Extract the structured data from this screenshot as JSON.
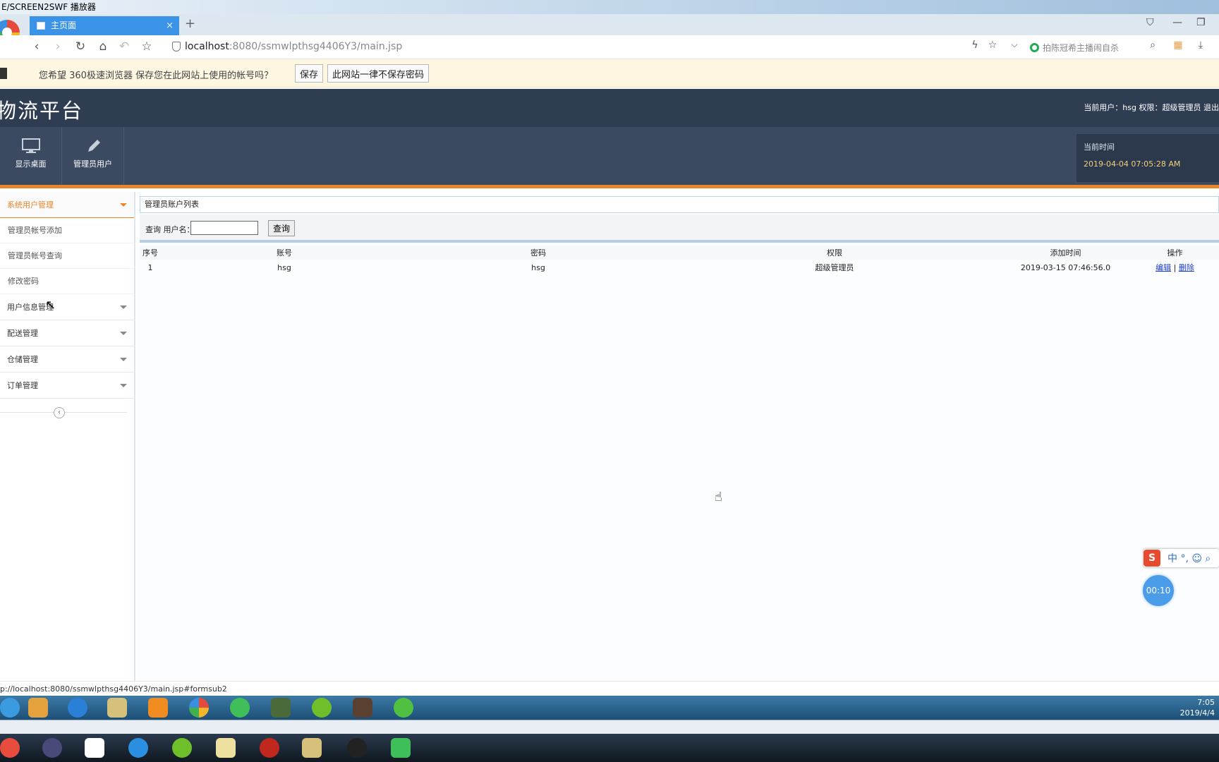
{
  "player": {
    "title": "E/SCREEN2SWF 播放器"
  },
  "browser": {
    "tab_title": "主页面",
    "url_host": "localhost",
    "url_path": ":8080/ssmwlpthsg4406Y3/main.jsp",
    "search_hint": "拍陈冠希主播闹自杀",
    "password_prompt": {
      "message": "您希望 360极速浏览器 保存您在此网站上使用的帐号吗？",
      "save_label": "保存",
      "never_label": "此网站一律不保存密码"
    },
    "status_url": "p://localhost:8080/ssmwlpthsg4406Y3/main.jsp#formsub2"
  },
  "app": {
    "title": "物流平台",
    "user_info": "当前用户：hsg 权限：超级管理员 退出",
    "toolbar": [
      {
        "label": "显示桌面",
        "icon": "monitor-icon"
      },
      {
        "label": "管理员用户",
        "icon": "pencil-icon"
      }
    ],
    "time_label": "当前时间",
    "time_value": "2019-04-04 07:05:28 AM"
  },
  "sidebar": {
    "groups": [
      {
        "label": "系统用户管理",
        "active": true,
        "items": [
          "管理员帐号添加",
          "管理员帐号查询",
          "修改密码"
        ]
      },
      {
        "label": "用户信息管理",
        "active": false,
        "items": []
      },
      {
        "label": "配送管理",
        "active": false,
        "items": []
      },
      {
        "label": "仓储管理",
        "active": false,
        "items": []
      },
      {
        "label": "订单管理",
        "active": false,
        "items": []
      }
    ]
  },
  "main": {
    "panel_title": "管理员账户列表",
    "query_label": "查询 用户名：",
    "query_value": "",
    "query_button": "查询",
    "columns": [
      "序号",
      "账号",
      "密码",
      "权限",
      "添加时间",
      "操作"
    ],
    "rows": [
      {
        "no": "1",
        "account": "hsg",
        "password": "hsg",
        "role": "超级管理员",
        "added": "2019-03-15 07:46:56.0",
        "edit": "编辑",
        "sep": "|",
        "delete": "删除"
      }
    ]
  },
  "overlay": {
    "ime_logo": "S",
    "ime_text": "中 °, ☺ ⌕",
    "timer": "00:10"
  },
  "clock": {
    "time": "7:05",
    "date": "2019/4/4"
  }
}
